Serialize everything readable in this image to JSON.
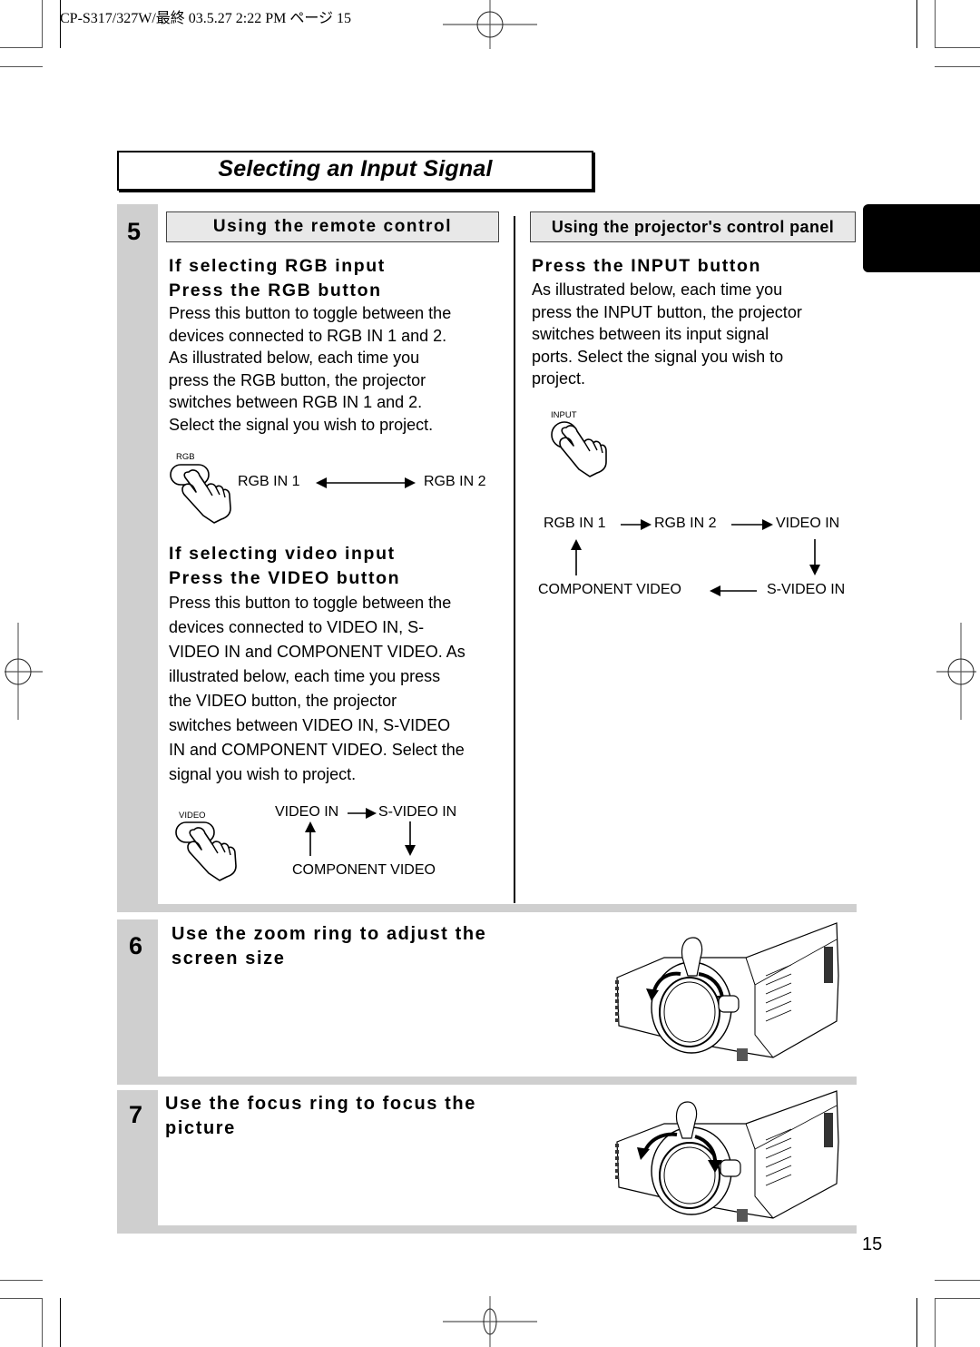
{
  "print_header": "CP-S317/327W/最終  03.5.27 2:22 PM  ページ 15",
  "page_title": "Selecting an Input Signal",
  "steps": [
    {
      "number": "5",
      "remote_section": {
        "heading": "Using the remote control",
        "rgb": {
          "title_line1": "If selecting RGB input",
          "title_line2": "Press the RGB button",
          "body": [
            "Press this button to toggle between the",
            "devices connected to RGB IN 1 and 2.",
            "As illustrated below, each time you",
            "press the RGB button, the projector",
            "switches between RGB IN 1 and 2.",
            "Select the signal you wish to project."
          ],
          "diagram": {
            "button_label": "RGB",
            "nodes": [
              "RGB IN 1",
              "RGB IN 2"
            ]
          }
        },
        "video": {
          "title_line1": "If selecting video input",
          "title_line2": "Press the VIDEO button",
          "body": [
            "Press this button to toggle between the",
            "devices connected to VIDEO IN, S-",
            "VIDEO IN and COMPONENT VIDEO. As",
            "illustrated below, each time you press",
            "the VIDEO button, the projector",
            "switches between VIDEO IN, S-VIDEO",
            "IN and COMPONENT VIDEO. Select the",
            "signal you wish to project."
          ],
          "diagram": {
            "button_label": "VIDEO",
            "nodes": [
              "VIDEO IN",
              "S-VIDEO IN",
              "COMPONENT VIDEO"
            ]
          }
        }
      },
      "panel_section": {
        "heading": "Using the projector's control panel",
        "title": "Press the INPUT button",
        "body": [
          "As illustrated below, each time you",
          "press the INPUT button, the projector",
          "switches between its input signal",
          "ports. Select the signal you wish to",
          "project."
        ],
        "diagram": {
          "button_label": "INPUT",
          "nodes": [
            "RGB IN 1",
            "RGB IN 2",
            "VIDEO IN",
            "S-VIDEO IN",
            "COMPONENT VIDEO"
          ]
        }
      }
    },
    {
      "number": "6",
      "title_line1": "Use the zoom ring to adjust the",
      "title_line2": "screen size",
      "illustration": "projector-zoom-ring"
    },
    {
      "number": "7",
      "title_line1": "Use the focus ring to focus the",
      "title_line2": "picture",
      "illustration": "projector-focus-ring"
    }
  ],
  "page_number": "15"
}
